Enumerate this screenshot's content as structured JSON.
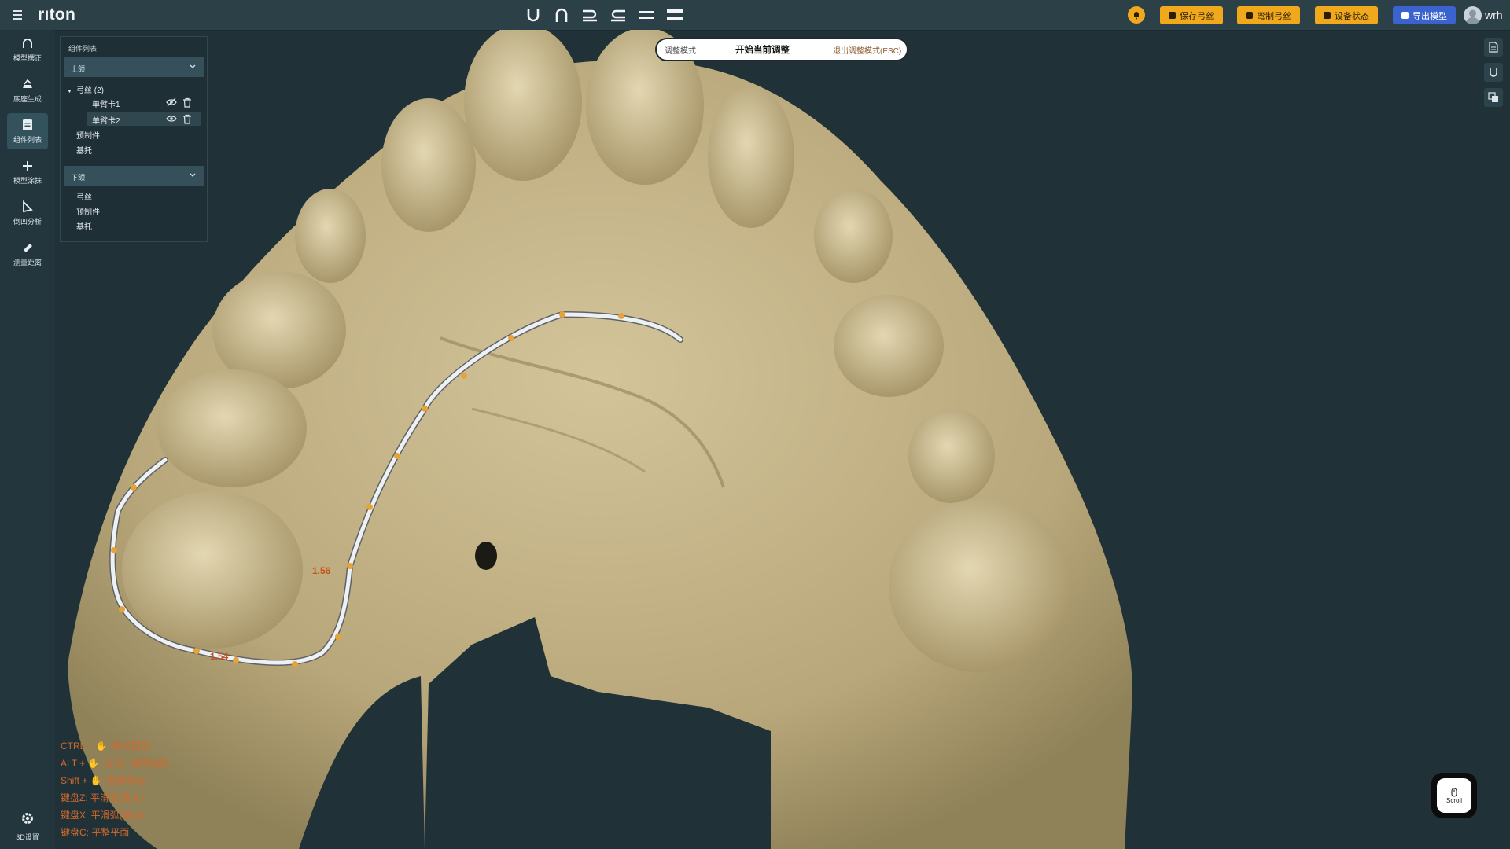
{
  "app": {
    "logo_text": "rı",
    "logo_text2": "ton",
    "accent": "#f0a81d",
    "brand_dot": "#e03b2c"
  },
  "toolbar": {
    "center_tools": [
      "u-shape-icon",
      "arch-shape-icon",
      "bend-right-icon",
      "bend-left-icon",
      "parallel-lines-icon",
      "double-bar-icon"
    ],
    "buttons": [
      {
        "label": "保存弓丝",
        "style": "orange"
      },
      {
        "label": "弯制弓丝",
        "style": "orange"
      },
      {
        "label": "设备状态",
        "style": "orange"
      },
      {
        "label": "导出模型",
        "style": "blue"
      }
    ],
    "username": "wrh"
  },
  "sidebar": {
    "items": [
      {
        "label": "模型摆正",
        "icon": "arch-outline-icon"
      },
      {
        "label": "底座生成",
        "icon": "base-generate-icon"
      },
      {
        "label": "组件列表",
        "icon": "component-list-icon",
        "active": true
      },
      {
        "label": "模型涂抹",
        "icon": "smear-icon"
      },
      {
        "label": "倒凹分析",
        "icon": "undercut-analysis-icon"
      },
      {
        "label": "测量距离",
        "icon": "ruler-icon"
      }
    ],
    "settings_label": "3D设置"
  },
  "panel": {
    "title": "组件列表",
    "upper": {
      "label": "上颌",
      "group_label": "弓丝 (2)",
      "children": [
        "单臂卡1",
        "单臂卡2"
      ],
      "others": [
        "预制件",
        "基托"
      ]
    },
    "lower": {
      "label": "下颌",
      "items": [
        "弓丝",
        "预制件",
        "基托"
      ]
    }
  },
  "mode_bar": {
    "mode_label": "调整模式",
    "start_label": "开始当前调整",
    "exit_label": "退出调整模式(ESC)"
  },
  "measurements": [
    "1.56",
    "1.54"
  ],
  "hints": [
    "CTRL + ✋: 移动圆弧",
    "ALT + ✋: 压低 / 拔高圆弧",
    "Shift + ✋: 整体移动",
    "键盘Z: 平滑弧(放大)",
    "键盘X: 平滑弧(减小)",
    "键盘C: 平整平面"
  ],
  "scroll_widget": {
    "label": "Scroll"
  }
}
